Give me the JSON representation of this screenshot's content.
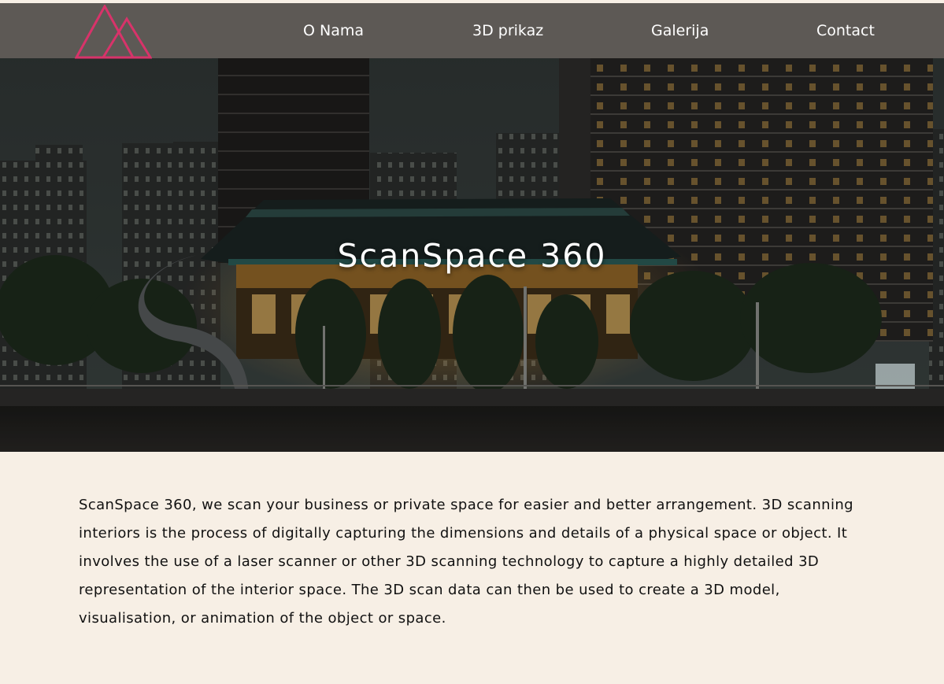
{
  "brand": {
    "logo_icon": "twin-triangle-logo-icon",
    "logo_color": "#d8336a"
  },
  "nav": {
    "items": [
      {
        "label": "O Nama"
      },
      {
        "label": "3D prikaz"
      },
      {
        "label": "Galerija"
      },
      {
        "label": "Contact"
      }
    ],
    "background": "#5d5955"
  },
  "hero": {
    "title": "ScanSpace 360",
    "image": "night-city-temple-photo"
  },
  "about": {
    "text": "ScanSpace 360, we scan your business or private space for easier and better arrangement. 3D scanning interiors is the process of digitally capturing the dimensions and details of a physical space or object. It involves the use of a laser scanner or other 3D scanning technology to capture a highly detailed 3D representation of the interior space. The 3D scan data can then be used to create a 3D model, visualisation, or animation of the object or space.",
    "background": "#f7efe5"
  }
}
